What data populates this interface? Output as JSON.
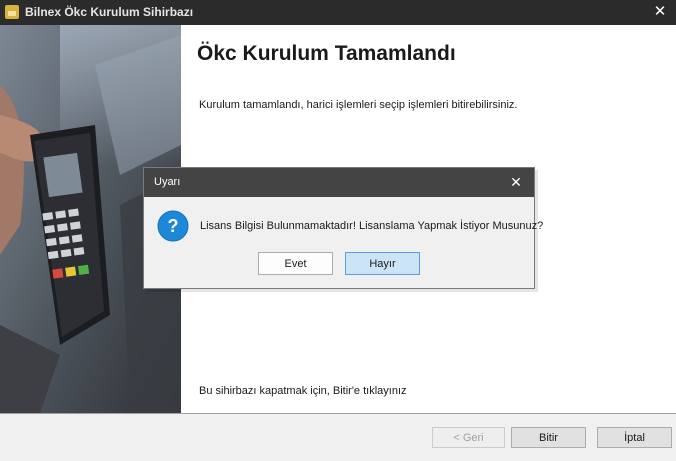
{
  "window": {
    "title": "Bilnex Ökc Kurulum Sihirbazı",
    "close_glyph": "✕"
  },
  "page": {
    "heading": "Ökc Kurulum Tamamlandı",
    "description": "Kurulum tamamlandı, harici işlemleri seçip işlemleri bitirebilirsiniz.",
    "footer_note": "Bu sihirbazı kapatmak için, Bitir'e tıklayınız"
  },
  "buttons": {
    "back": "< Geri",
    "finish": "Bitir",
    "cancel": "İptal"
  },
  "dialog": {
    "title": "Uyarı",
    "close_glyph": "✕",
    "icon": "question-icon",
    "message": "Lisans Bilgisi Bulunmamaktadır! Lisanslama Yapmak İstiyor Musunuz?",
    "yes": "Evet",
    "no": "Hayır"
  },
  "colors": {
    "titlebar": "#2b2b2b",
    "dialog_titlebar": "#444444",
    "question_icon": "#1e88d8",
    "focused_button": "#cce4f7"
  }
}
